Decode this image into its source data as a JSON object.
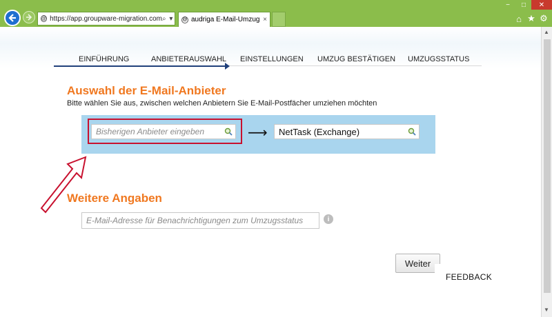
{
  "browser": {
    "address_url": "https://app.groupware-migration.com",
    "address_controls": "⌕ ▾ 🔒 ↻",
    "tab_title": "audriga E-Mail-Umzug",
    "tab_close": "×",
    "window_minimize": "−",
    "window_maximize": "□",
    "window_close": "✕",
    "icons": [
      "back-arrow-icon",
      "forward-arrow-icon",
      "home-icon",
      "star-icon",
      "gear-icon"
    ]
  },
  "wizard": {
    "steps": [
      "EINFÜHRUNG",
      "ANBIETERAUSWAHL",
      "EINSTELLUNGEN",
      "UMZUG BESTÄTIGEN",
      "UMZUGSSTATUS"
    ],
    "active_step": "ANBIETERAUSWAHL"
  },
  "providers": {
    "heading": "Auswahl der E-Mail-Anbieter",
    "subtitle": "Bitte wählen Sie aus, zwischen welchen Anbietern Sie E-Mail-Postfächer umziehen möchten",
    "source_placeholder": "Bisherigen Anbieter eingeben",
    "arrow": "⟶",
    "target_value": "NetTask (Exchange)"
  },
  "more": {
    "heading": "Weitere Angaben",
    "email_placeholder": "E-Mail-Adresse für Benachrichtigungen zum Umzugsstatus",
    "info_glyph": "i"
  },
  "buttons": {
    "next_label": "Weiter",
    "feedback_label": "FEEDBACK"
  },
  "colors": {
    "accent_orange": "#f07820",
    "provider_box": "#a9d5ee",
    "highlight_red": "#c8102e",
    "progress_blue": "#1f3f7a",
    "chrome_green": "#8bbd4b"
  }
}
